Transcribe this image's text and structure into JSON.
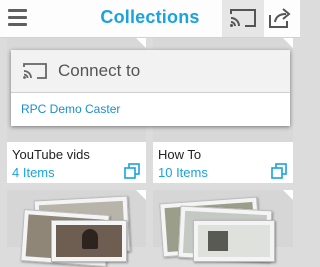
{
  "header": {
    "title": "Collections",
    "icons": {
      "menu": "menu-icon",
      "cast": "cast-icon",
      "share": "share-icon"
    }
  },
  "collections": [
    {
      "name": "YouTube vids",
      "count": "4 Items"
    },
    {
      "name": "How To",
      "count": "10 Items"
    }
  ],
  "cast_dialog": {
    "title": "Connect to",
    "devices": [
      "RPC Demo Caster"
    ]
  },
  "colors": {
    "accent": "#1aa3de",
    "text": "#222222"
  }
}
